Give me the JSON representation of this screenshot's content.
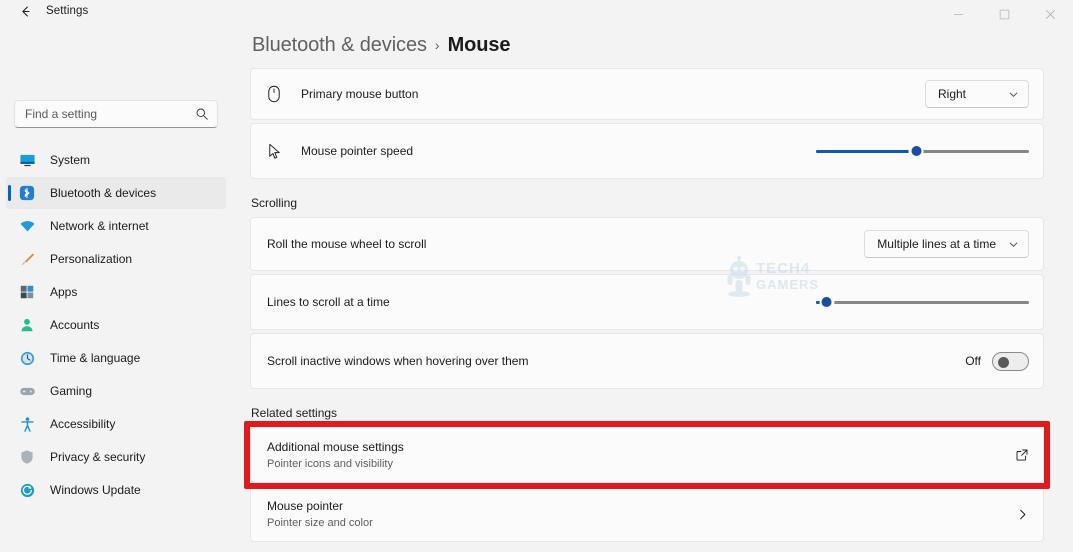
{
  "window": {
    "title": "Settings",
    "back_icon": "back-arrow-icon",
    "controls": [
      {
        "name": "minimize",
        "glyph": "minimize-icon"
      },
      {
        "name": "maximize",
        "glyph": "maximize-icon"
      },
      {
        "name": "close",
        "glyph": "close-icon"
      }
    ]
  },
  "search": {
    "placeholder": "Find a setting",
    "value": "",
    "icon": "search-icon"
  },
  "sidebar": {
    "items": [
      {
        "label": "System",
        "icon": "system-icon",
        "active": false
      },
      {
        "label": "Bluetooth & devices",
        "icon": "bluetooth-icon",
        "active": true
      },
      {
        "label": "Network & internet",
        "icon": "network-icon",
        "active": false
      },
      {
        "label": "Personalization",
        "icon": "personalization-icon",
        "active": false
      },
      {
        "label": "Apps",
        "icon": "apps-icon",
        "active": false
      },
      {
        "label": "Accounts",
        "icon": "accounts-icon",
        "active": false
      },
      {
        "label": "Time & language",
        "icon": "time-icon",
        "active": false
      },
      {
        "label": "Gaming",
        "icon": "gaming-icon",
        "active": false
      },
      {
        "label": "Accessibility",
        "icon": "accessibility-icon",
        "active": false
      },
      {
        "label": "Privacy & security",
        "icon": "privacy-icon",
        "active": false
      },
      {
        "label": "Windows Update",
        "icon": "update-icon",
        "active": false
      }
    ]
  },
  "breadcrumb": {
    "parent": "Bluetooth & devices",
    "separator": "›",
    "current": "Mouse"
  },
  "settings": {
    "primary_mouse_button": {
      "label": "Primary mouse button",
      "icon": "mouse-icon",
      "value": "Right",
      "chevron": "chevron-down-icon"
    },
    "pointer_speed": {
      "label": "Mouse pointer speed",
      "icon": "cursor-icon",
      "percent": 47
    },
    "scrolling_header": "Scrolling",
    "mouse_wheel": {
      "label": "Roll the mouse wheel to scroll",
      "value": "Multiple lines at a time",
      "chevron": "chevron-down-icon"
    },
    "lines_to_scroll": {
      "label": "Lines to scroll at a time",
      "percent": 5
    },
    "scroll_inactive": {
      "label": "Scroll inactive windows when hovering over them",
      "state": "Off",
      "on": false
    },
    "related_header": "Related settings",
    "additional_mouse_settings": {
      "title": "Additional mouse settings",
      "subtitle": "Pointer icons and visibility",
      "icon": "external-link-icon",
      "highlighted": true
    },
    "mouse_pointer": {
      "title": "Mouse pointer",
      "subtitle": "Pointer size and color",
      "icon": "chevron-right-icon"
    }
  },
  "watermark": {
    "line1": "TECH4",
    "line2": "GAMERS"
  },
  "colors": {
    "accent": "#0067c0",
    "slider_fill": "#0f5ab4",
    "highlight_box": "#e01b20",
    "page_bg": "#f3f3f3",
    "card_bg": "#fbfbfb"
  }
}
